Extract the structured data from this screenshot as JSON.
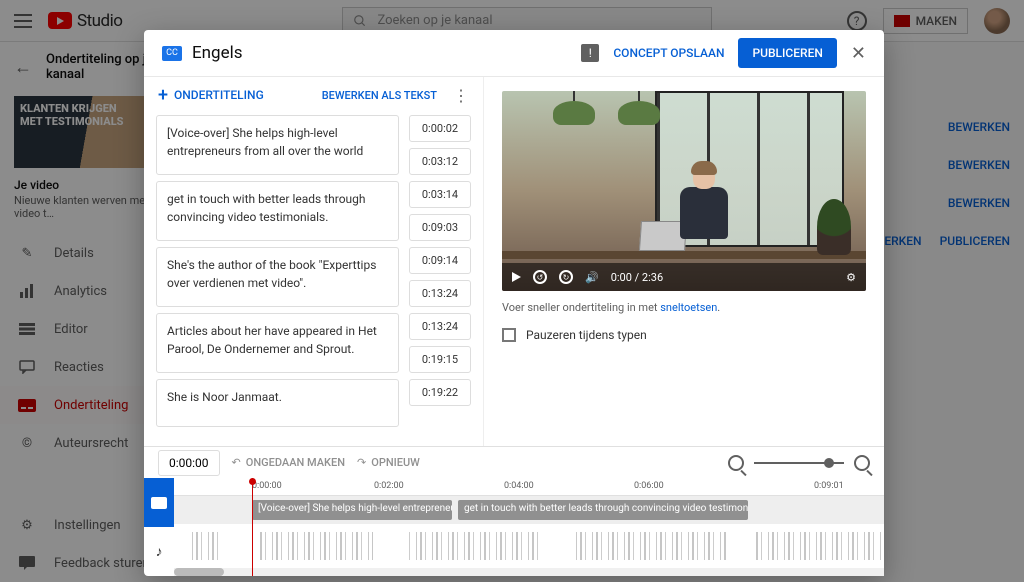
{
  "header": {
    "studio_label": "Studio",
    "search_placeholder": "Zoeken op je kanaal",
    "maken_label": "MAKEN"
  },
  "sidebar": {
    "back_title": "Ondertiteling op je kanaal",
    "thumb_overlay": "KLANTEN KRIJGEN MET TESTIMONIALS",
    "video_label": "Je video",
    "video_title": "Nieuwe klanten werven met video t…",
    "items": [
      {
        "label": "Details"
      },
      {
        "label": "Analytics"
      },
      {
        "label": "Editor"
      },
      {
        "label": "Reacties"
      },
      {
        "label": "Ondertiteling"
      },
      {
        "label": "Auteursrecht"
      }
    ],
    "footer": [
      {
        "label": "Instellingen"
      },
      {
        "label": "Feedback sturen"
      }
    ]
  },
  "bg": {
    "bewerken": "BEWERKEN",
    "publiceren": "PUBLICEREN"
  },
  "dialog": {
    "cc_badge": "CC",
    "language": "Engels",
    "draft_btn": "CONCEPT OPSLAAN",
    "publish_btn": "PUBLICEREN",
    "add_subtitle": "ONDERTITELING",
    "edit_as_text": "BEWERKEN ALS TEKST",
    "tip_prefix": "Voer sneller ondertiteling in met ",
    "tip_link": "sneltoetsen",
    "pause_label": "Pauzeren tijdens typen",
    "captions": [
      {
        "text": "[Voice-over] She helps high-level entrepreneurs from all over the world",
        "in": "0:00:02",
        "out": "0:03:12"
      },
      {
        "text": "get in touch with better leads through convincing video testimonials.",
        "in": "0:03:14",
        "out": "0:09:03"
      },
      {
        "text": "She's the author of the book \"Experttips over verdienen met video\".",
        "in": "0:09:14",
        "out": "0:13:24"
      },
      {
        "text": "Articles about her have appeared in Het Parool, De Ondernemer and Sprout.",
        "in": "0:13:24",
        "out": "0:19:15"
      },
      {
        "text": "She is Noor Janmaat.",
        "in": "0:19:22",
        "out": ""
      }
    ],
    "video": {
      "current": "0:00",
      "duration": "2:36"
    }
  },
  "timeline": {
    "current_time": "0:00:00",
    "undo": "ONGEDAAN MAKEN",
    "redo": "OPNIEUW",
    "ruler": [
      "0:00:00",
      "0:02:00",
      "0:04:00",
      "0:06:00",
      "0:09:01"
    ],
    "seg_a": "[Voice-over] She helps high-level entrepreneurs from all o…",
    "seg_b": "get in touch with better leads through convincing video testimonials."
  }
}
